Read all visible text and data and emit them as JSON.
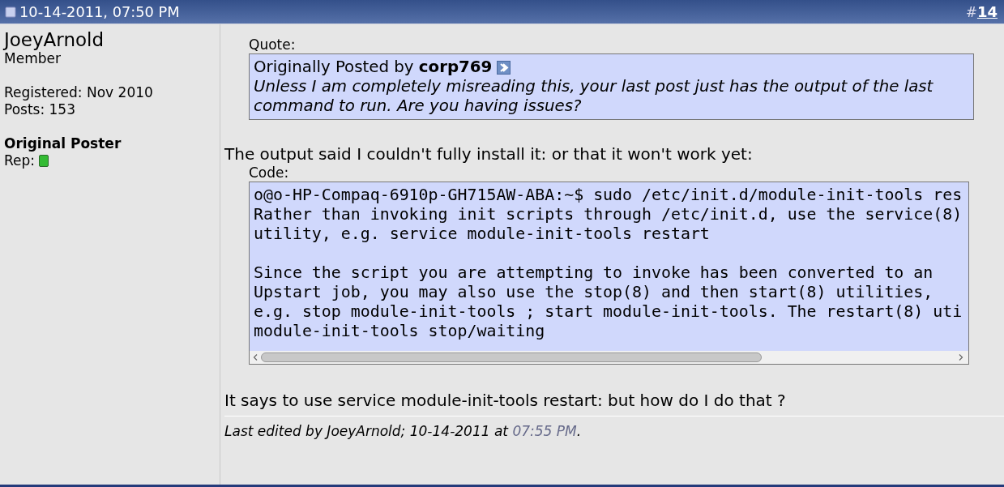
{
  "header": {
    "date": "10-14-2011, 07:50 PM",
    "post_hash": "#",
    "post_number": "14"
  },
  "user": {
    "name": "JoeyArnold",
    "title": "Member",
    "registered": "Registered: Nov 2010",
    "posts": "Posts: 153",
    "badge": "Original Poster",
    "rep_label": "Rep:"
  },
  "quote": {
    "label": "Quote:",
    "attribution": "Originally Posted by **corp769**",
    "text": "Unless I am completely misreading this, your last post just has the output of the last command to run. Are you having issues?"
  },
  "paragraphs": [
    "The output said I couldn't fully install it: or that it won't work yet:"
  ],
  "code": {
    "label": "Code:",
    "text": "o@o-HP-Compaq-6910p-GH715AW-ABA:~$ sudo /etc/init.d/module-init-tools res\nRather than invoking init scripts through /etc/init.d, use the service(8)\nutility, e.g. service module-init-tools restart\n\nSince the script you are attempting to invoke has been converted to an\nUpstart job, you may also use the stop(8) and then start(8) utilities,\ne.g. stop module-init-tools ; start module-init-tools. The restart(8) uti\nmodule-init-tools stop/waiting"
  },
  "closing": "It says to use service module-init-tools restart: but how do I do that ?",
  "edited": {
    "text": "Last edited by JoeyArnold; 10-14-2011 at",
    "time": "07:55 PM",
    "end": "."
  }
}
